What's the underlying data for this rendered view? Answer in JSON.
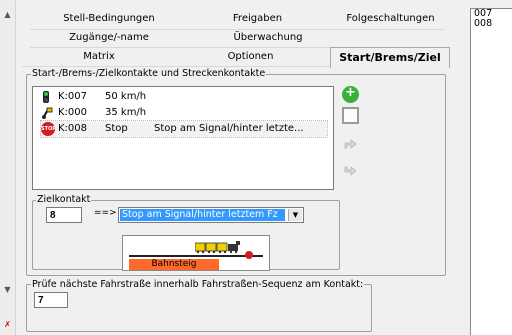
{
  "tabs": {
    "row1": [
      "Stell-Bedingungen",
      "Freigaben",
      "Folgeschaltungen"
    ],
    "row2": [
      "Zugänge/-name",
      "Überwachung"
    ],
    "row3": [
      "Matrix",
      "Optionen",
      "Start/Brems/Ziel"
    ]
  },
  "contacts_group": {
    "title": "Start-/Brems-/Zielkontakte und Streckenkontakte",
    "rows": [
      {
        "icon": "signal-icon",
        "contact": "K:007",
        "value": "50 km/h",
        "text": ""
      },
      {
        "icon": "flag-icon",
        "contact": "K:000",
        "value": "35 km/h",
        "text": ""
      },
      {
        "icon": "stop-icon",
        "contact": "K:008",
        "value": "Stop",
        "text": "Stop am Signal/hinter letzte...",
        "stop_label": "STOP"
      }
    ]
  },
  "target_group": {
    "title": "Zielkontakt",
    "contact_value": "8",
    "arrow": "==>",
    "selected_option": "Stop am Signal/hinter letztem Fz",
    "platform_label": "Bahnsteig"
  },
  "check_group": {
    "title": "Prüfe nächste Fahrstraße innerhalb Fahrstraßen-Sequenz am Kontakt:",
    "value": "7"
  },
  "right_list": {
    "items": [
      "007",
      "008"
    ]
  },
  "colors": {
    "selection": "#3399ff",
    "platform": "#ff6a2a",
    "stop_red": "#d41e1e",
    "add_green": "#3cb03c"
  }
}
